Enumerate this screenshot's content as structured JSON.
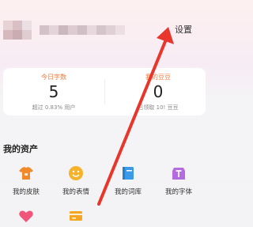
{
  "header": {
    "settings_label": "设置"
  },
  "stats": [
    {
      "title": "今日字数",
      "value": "5",
      "sub": "超过 0.83% 用户"
    },
    {
      "title": "我的豆豆",
      "value": "0",
      "sub": "已领取 10! 豆豆"
    }
  ],
  "assets": {
    "title": "我的资产",
    "items": [
      {
        "label": "我的皮肤",
        "icon": "shirt-icon",
        "color": "#f08a2a"
      },
      {
        "label": "我的表情",
        "icon": "smile-icon",
        "color": "#f5b32c"
      },
      {
        "label": "我的词库",
        "icon": "book-icon",
        "color": "#3a9ae8"
      },
      {
        "label": "我的字体",
        "icon": "font-icon",
        "color": "#b46ae0"
      },
      {
        "label": "",
        "icon": "heart-icon",
        "color": "#f0567a"
      },
      {
        "label": "",
        "icon": "card-icon",
        "color": "#f5a623"
      }
    ]
  },
  "annotation": {
    "arrow_color": "#e8362c"
  }
}
